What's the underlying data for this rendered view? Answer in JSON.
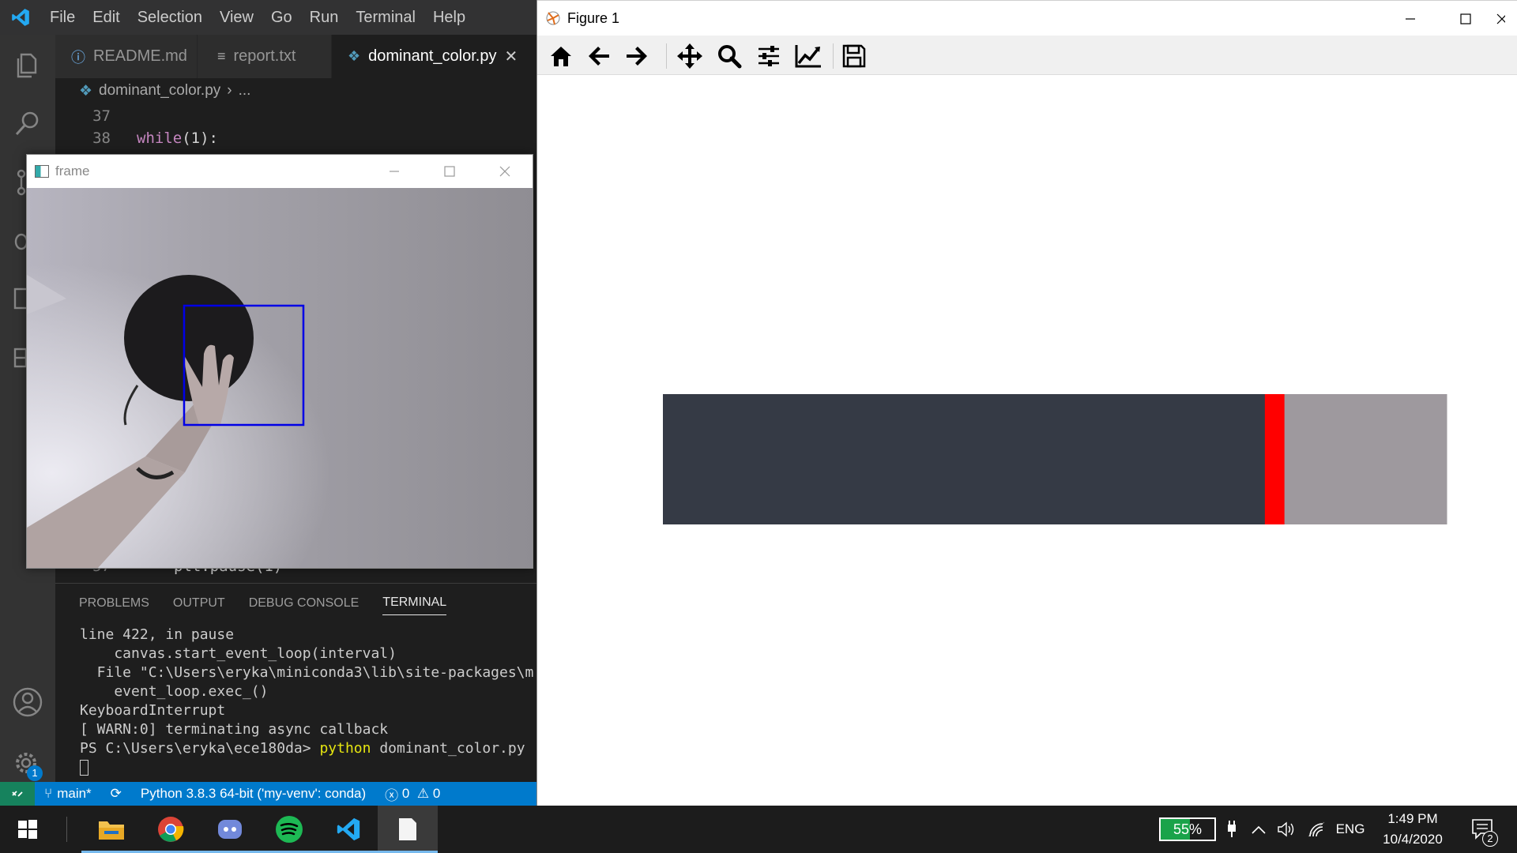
{
  "vscode": {
    "menu": [
      "File",
      "Edit",
      "Selection",
      "View",
      "Go",
      "Run",
      "Terminal",
      "Help"
    ],
    "tabs": [
      {
        "label": "README.md",
        "icon": "info-icon"
      },
      {
        "label": "report.txt",
        "icon": "text-file-icon"
      },
      {
        "label": "dominant_color.py",
        "icon": "python-icon"
      }
    ],
    "breadcrumb": {
      "file": "dominant_color.py",
      "rest": "..."
    },
    "code": [
      {
        "line": "37",
        "text": ""
      },
      {
        "line": "38",
        "keyword": "while",
        "text": "(1):"
      }
    ],
    "code_bottom": {
      "line": "57",
      "text": "plt.pause(1)"
    },
    "panel_tabs": [
      "PROBLEMS",
      "OUTPUT",
      "DEBUG CONSOLE",
      "TERMINAL"
    ],
    "terminal": [
      "line 422, in pause",
      "    canvas.start_event_loop(interval)",
      "  File \"C:\\Users\\eryka\\miniconda3\\lib\\site-packages\\m",
      "    event_loop.exec_()",
      "KeyboardInterrupt",
      "[ WARN:0] terminating async callback"
    ],
    "prompt": "PS C:\\Users\\eryka\\ece180da>",
    "prompt_cmd": "python",
    "prompt_args": "dominant_color.py",
    "status": {
      "branch": "main*",
      "interpreter": "Python 3.8.3 64-bit ('my-venv': conda)",
      "errors": "0",
      "warnings": "0"
    },
    "settings_badge": "1"
  },
  "frame_window": {
    "title": "frame"
  },
  "figure": {
    "title": "Figure 1",
    "toolbar": [
      "home-icon",
      "back-icon",
      "forward-icon",
      "pan-icon",
      "zoom-icon",
      "configure-subplots-icon",
      "edit-axis-icon",
      "save-icon"
    ],
    "colors": {
      "dark": "#353a45",
      "red": "#ff0000",
      "gray": "#9e999e"
    }
  },
  "chart_data": {
    "type": "bar",
    "title": "",
    "orientation": "horizontal-stacked",
    "series": [
      {
        "color": "#353a45",
        "value": 0.768
      },
      {
        "color": "#ff0000",
        "value": 0.025
      },
      {
        "color": "#9e999e",
        "value": 0.207
      }
    ],
    "xlim": [
      0,
      1
    ],
    "grid": false,
    "axes_visible": false
  },
  "taskbar": {
    "battery": "55%",
    "language": "ENG",
    "time": "1:49 PM",
    "date": "10/4/2020",
    "notification_count": "2"
  }
}
